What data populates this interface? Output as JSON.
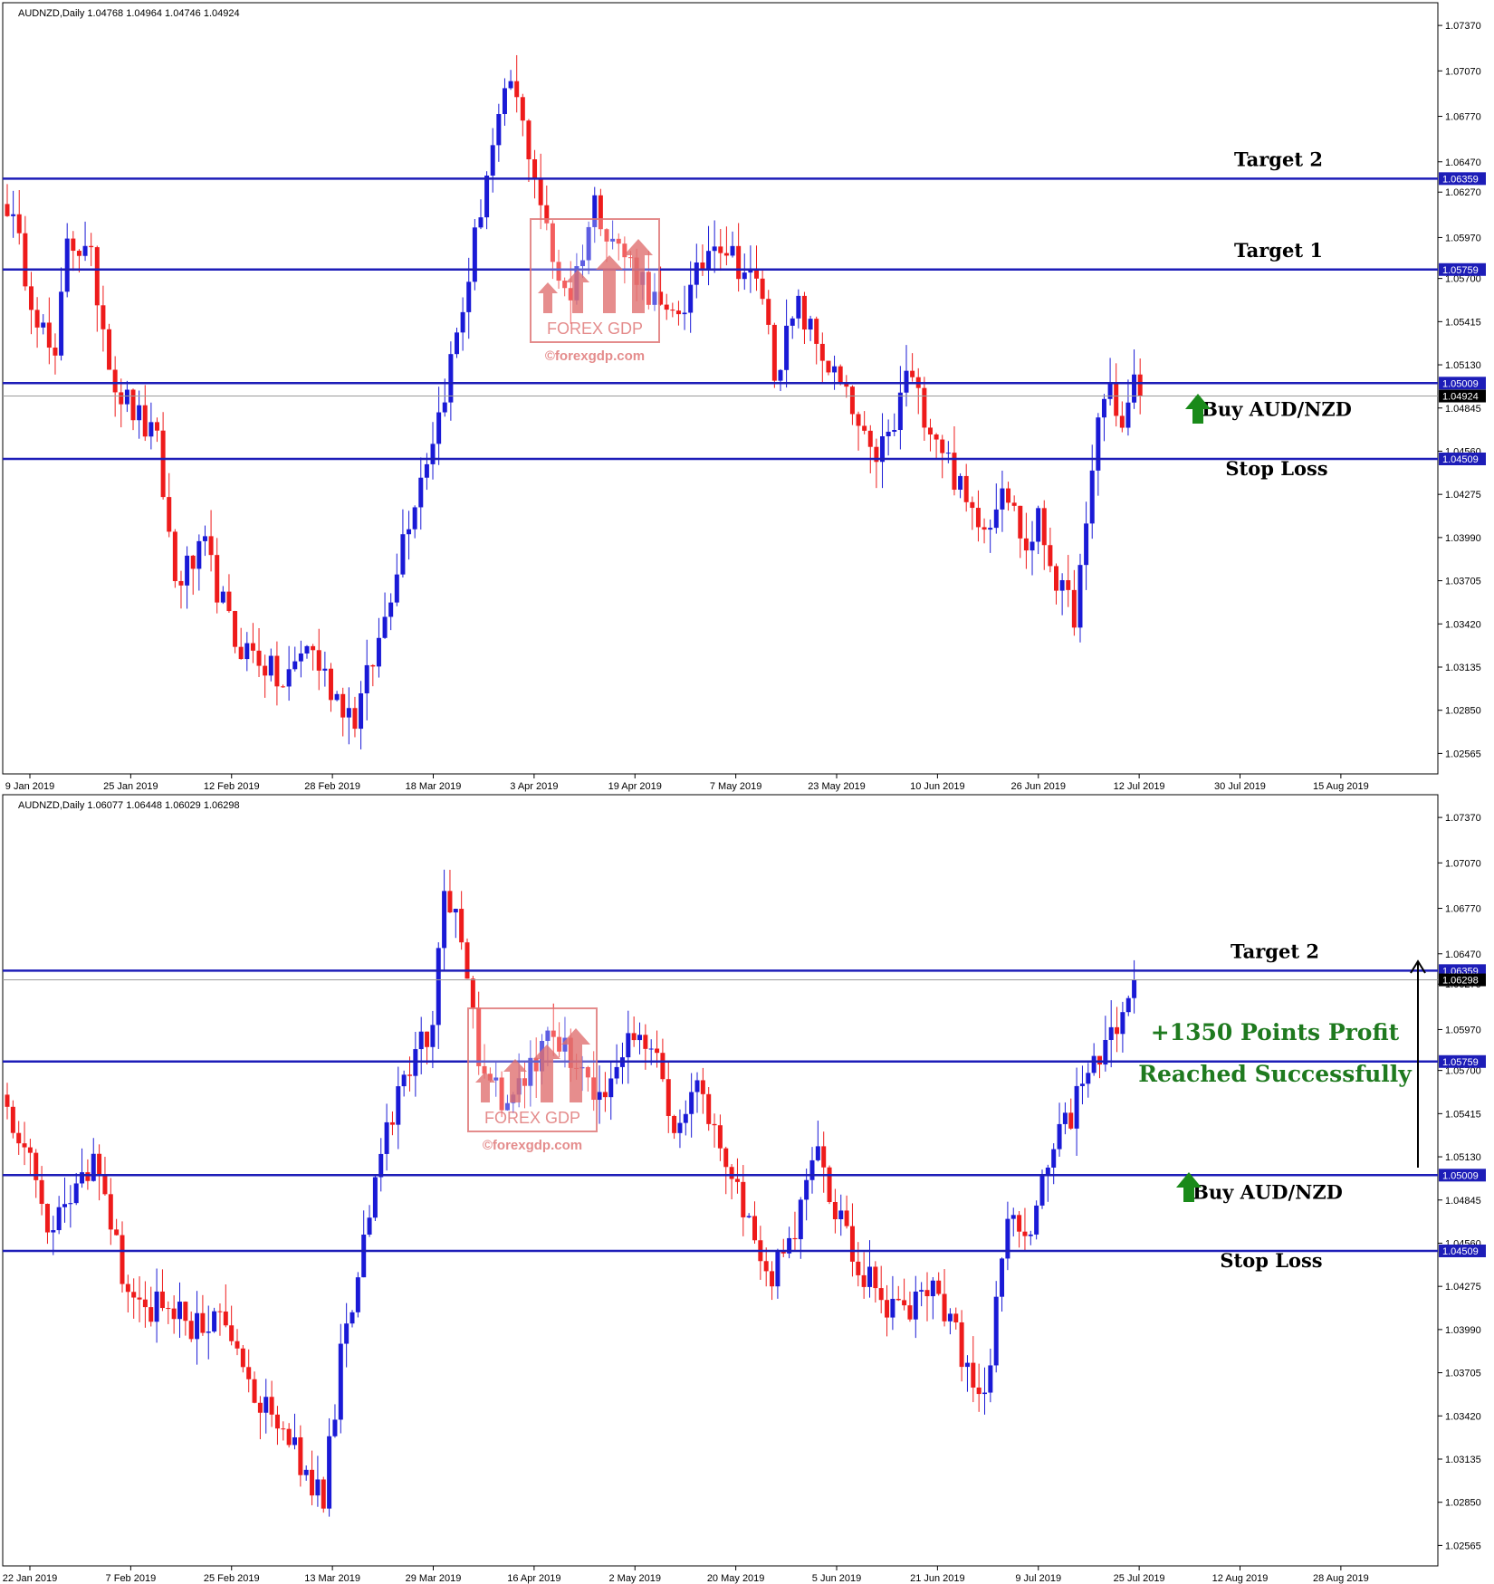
{
  "colors": {
    "bull": "#1a1ad6",
    "bear": "#ee1b1b",
    "level": "#1d1db8",
    "axis_text": "#000000",
    "tag_bg": "#1d1db8",
    "tag_text": "#ffffff",
    "green": "#1f7a1f",
    "watermark": "#e07878"
  },
  "chart_data": [
    {
      "type": "candlestick",
      "title": "AUDNZD,Daily  1.04768 1.04964 1.04746 1.04924",
      "ylim": [
        1.0243,
        1.0752
      ],
      "y_ticks": [
        "1.07370",
        "1.07070",
        "1.06770",
        "1.06470",
        "1.06270",
        "1.05970",
        "1.05700",
        "1.05415",
        "1.05130",
        "1.04845",
        "1.04560",
        "1.04275",
        "1.03990",
        "1.03705",
        "1.03420",
        "1.03135",
        "1.02850",
        "1.02565"
      ],
      "x_ticks": [
        "9 Jan 2019",
        "25 Jan 2019",
        "12 Feb 2019",
        "28 Feb 2019",
        "18 Mar 2019",
        "3 Apr 2019",
        "19 Apr 2019",
        "7 May 2019",
        "23 May 2019",
        "10 Jun 2019",
        "26 Jun 2019",
        "12 Jul 2019",
        "30 Jul 2019",
        "15 Aug 2019"
      ],
      "levels": [
        {
          "value": 1.06359,
          "tag": "1.06359",
          "label": "Target 2"
        },
        {
          "value": 1.05759,
          "tag": "1.05759",
          "label": "Target 1"
        },
        {
          "value": 1.05009,
          "tag": "1.05009",
          "label": "Buy AUD/NZD"
        },
        {
          "value": 1.04509,
          "tag": "1.04509",
          "label": "Stop Loss"
        }
      ],
      "current_price": {
        "value": 1.04924,
        "tag": "1.04924"
      },
      "anchor_points": [
        [
          0,
          1.062
        ],
        [
          4,
          1.056
        ],
        [
          8,
          1.051
        ],
        [
          10,
          1.06
        ],
        [
          14,
          1.058
        ],
        [
          18,
          1.05
        ],
        [
          25,
          1.046
        ],
        [
          28,
          1.037
        ],
        [
          33,
          1.039
        ],
        [
          38,
          1.033
        ],
        [
          42,
          1.032
        ],
        [
          46,
          1.03
        ],
        [
          50,
          1.033
        ],
        [
          54,
          1.03
        ],
        [
          58,
          1.028
        ],
        [
          62,
          1.033
        ],
        [
          66,
          1.04
        ],
        [
          72,
          1.048
        ],
        [
          76,
          1.055
        ],
        [
          80,
          1.064
        ],
        [
          84,
          1.07
        ],
        [
          88,
          1.064
        ],
        [
          91,
          1.058
        ],
        [
          94,
          1.056
        ],
        [
          98,
          1.062
        ],
        [
          102,
          1.059
        ],
        [
          106,
          1.057
        ],
        [
          110,
          1.054
        ],
        [
          114,
          1.056
        ],
        [
          118,
          1.06
        ],
        [
          122,
          1.058
        ],
        [
          126,
          1.056
        ],
        [
          128,
          1.051
        ],
        [
          132,
          1.055
        ],
        [
          136,
          1.052
        ],
        [
          140,
          1.049
        ],
        [
          144,
          1.045
        ],
        [
          148,
          1.047
        ],
        [
          150,
          1.051
        ],
        [
          152,
          1.049
        ],
        [
          156,
          1.046
        ],
        [
          160,
          1.042
        ],
        [
          164,
          1.041
        ],
        [
          166,
          1.044
        ],
        [
          170,
          1.039
        ],
        [
          172,
          1.041
        ],
        [
          176,
          1.036
        ],
        [
          178,
          1.035
        ],
        [
          180,
          1.04
        ],
        [
          182,
          1.048
        ],
        [
          184,
          1.05
        ],
        [
          186,
          1.047
        ],
        [
          188,
          1.05
        ],
        [
          189,
          1.0492
        ]
      ]
    },
    {
      "type": "candlestick",
      "title": "AUDNZD,Daily  1.06077 1.06448 1.06029 1.06298",
      "ylim": [
        1.0243,
        1.0752
      ],
      "y_ticks": [
        "1.07370",
        "1.07070",
        "1.06770",
        "1.06470",
        "1.06270",
        "1.05970",
        "1.05700",
        "1.05415",
        "1.05130",
        "1.04845",
        "1.04560",
        "1.04275",
        "1.03990",
        "1.03705",
        "1.03420",
        "1.03135",
        "1.02850",
        "1.02565"
      ],
      "x_ticks": [
        "22 Jan 2019",
        "7 Feb 2019",
        "25 Feb 2019",
        "13 Mar 2019",
        "29 Mar 2019",
        "16 Apr 2019",
        "2 May 2019",
        "20 May 2019",
        "5 Jun 2019",
        "21 Jun 2019",
        "9 Jul 2019",
        "25 Jul 2019",
        "12 Aug 2019",
        "28 Aug 2019"
      ],
      "levels": [
        {
          "value": 1.06359,
          "tag": "1.06359",
          "label": "Target 2"
        },
        {
          "value": 1.05759,
          "tag": "1.05759",
          "label": ""
        },
        {
          "value": 1.05009,
          "tag": "1.05009",
          "label": "Buy AUD/NZD"
        },
        {
          "value": 1.04509,
          "tag": "1.04509",
          "label": "Stop Loss"
        }
      ],
      "current_price": {
        "value": 1.06298,
        "tag": "1.06298"
      },
      "anchor_points": [
        [
          0,
          1.054
        ],
        [
          4,
          1.051
        ],
        [
          8,
          1.046
        ],
        [
          12,
          1.05
        ],
        [
          16,
          1.051
        ],
        [
          20,
          1.044
        ],
        [
          24,
          1.041
        ],
        [
          28,
          1.042
        ],
        [
          32,
          1.04
        ],
        [
          36,
          1.041
        ],
        [
          40,
          1.038
        ],
        [
          44,
          1.035
        ],
        [
          48,
          1.034
        ],
        [
          52,
          1.03
        ],
        [
          55,
          1.029
        ],
        [
          58,
          1.038
        ],
        [
          62,
          1.046
        ],
        [
          66,
          1.053
        ],
        [
          70,
          1.057
        ],
        [
          74,
          1.06
        ],
        [
          76,
          1.068
        ],
        [
          79,
          1.066
        ],
        [
          82,
          1.058
        ],
        [
          86,
          1.055
        ],
        [
          90,
          1.056
        ],
        [
          94,
          1.06
        ],
        [
          98,
          1.058
        ],
        [
          102,
          1.055
        ],
        [
          106,
          1.057
        ],
        [
          110,
          1.06
        ],
        [
          114,
          1.057
        ],
        [
          116,
          1.053
        ],
        [
          120,
          1.056
        ],
        [
          124,
          1.052
        ],
        [
          128,
          1.048
        ],
        [
          132,
          1.043
        ],
        [
          136,
          1.045
        ],
        [
          140,
          1.052
        ],
        [
          144,
          1.048
        ],
        [
          148,
          1.044
        ],
        [
          152,
          1.042
        ],
        [
          156,
          1.041
        ],
        [
          160,
          1.043
        ],
        [
          164,
          1.041
        ],
        [
          168,
          1.036
        ],
        [
          170,
          1.035
        ],
        [
          172,
          1.042
        ],
        [
          174,
          1.047
        ],
        [
          178,
          1.047
        ],
        [
          182,
          1.052
        ],
        [
          186,
          1.055
        ],
        [
          190,
          1.058
        ],
        [
          194,
          1.06
        ],
        [
          196,
          1.063
        ]
      ]
    }
  ],
  "annotations": {
    "profit_line1": "+1350 Points Profit",
    "profit_line2": "Reached Successfully"
  },
  "watermark": {
    "brand": "FOREX GDP",
    "site": "©forexgdp.com"
  }
}
